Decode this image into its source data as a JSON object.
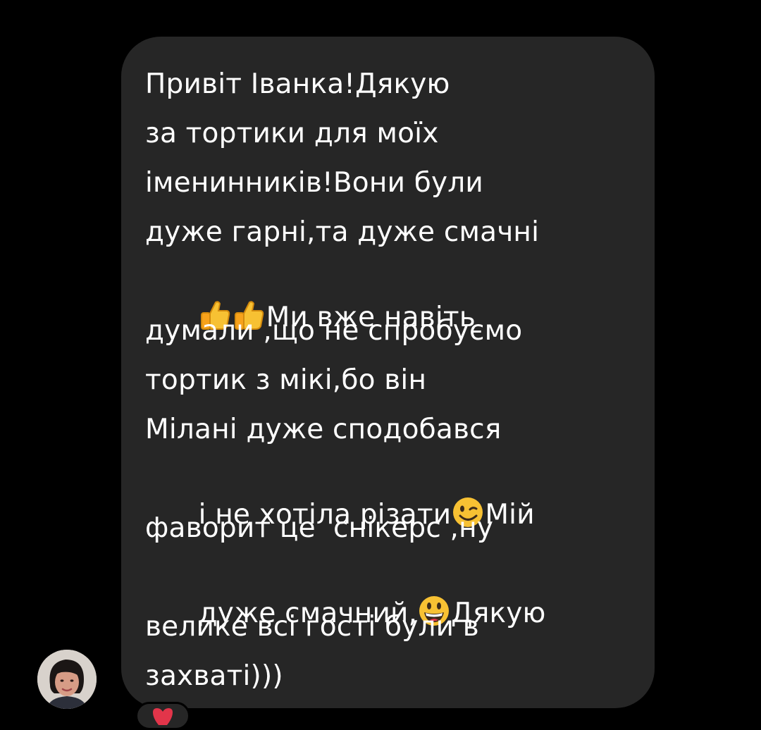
{
  "message": {
    "lines": [
      "Привіт Іванка!Дякую",
      "за тортики для моїх",
      "іменинників!Вони були",
      "дуже гарні,та дуже смачні",
      "Ми вже навіть",
      "думали ,що не спробуємо",
      "тортик з мікі,бо він",
      "Мілані дуже сподобався",
      "і не хотіла різати",
      "Мій",
      "фаворит це  снікерс ,ну",
      "дуже смачний,",
      "Дякую",
      "велике всі гості були в",
      "захваті)))"
    ]
  },
  "icons": {
    "thumbs_up": "thumbs-up-icon",
    "wink": "winking-face-icon",
    "grin": "grinning-face-icon",
    "heart": "heart-icon"
  },
  "colors": {
    "background": "#000000",
    "bubble": "#262626",
    "text": "#ffffff",
    "emoji_yellow": "#f7c133",
    "heart": "#e2354a"
  }
}
